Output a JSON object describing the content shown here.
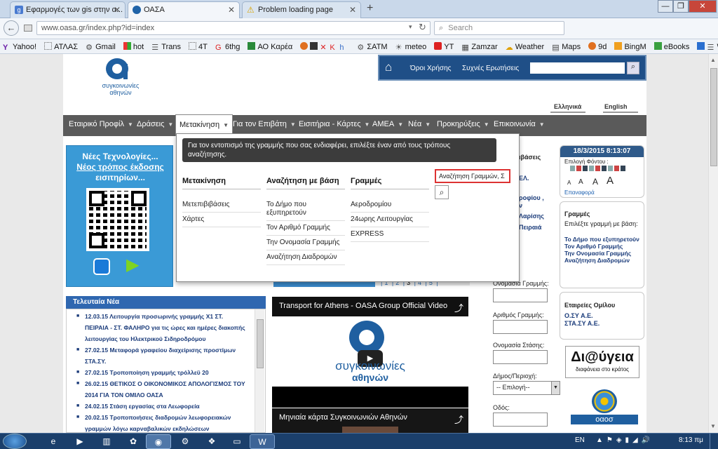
{
  "browser": {
    "tabs": [
      {
        "title": "Εφαρμογές των gis στην α...",
        "active": false
      },
      {
        "title": "ΟΑΣΑ",
        "active": true
      },
      {
        "title": "Problem loading page",
        "active": false
      }
    ],
    "new_tab_label": "+",
    "url": "www.oasa.gr/index.php?id=index",
    "search_placeholder": "Search",
    "bookmarks": [
      "Yahoo!",
      "ΑΤΛΑΣ",
      "Gmail",
      "hot",
      "Trans",
      "4T",
      "6thg",
      "ΑΟ Καρέα",
      "ΣΑΤΜ",
      "meteo",
      "YT",
      "Zamzar",
      "Weather",
      "Maps",
      "9d",
      "BingM",
      "eBooks",
      "WT"
    ]
  },
  "site": {
    "logo_text_line1": "συγκοινωνίες",
    "logo_text_line2": "αθηνών",
    "top_links": {
      "terms": "Όροι Χρήσης",
      "faq": "Συχνές Ερωτήσεις"
    },
    "languages": {
      "greek": "Ελληνικά",
      "english": "English"
    },
    "menu": [
      "Εταιρικό Προφίλ",
      "Δράσεις",
      "Μετακίνηση",
      "Για τον Επιβάτη",
      "Εισιτήρια - Κάρτες",
      "ΑΜΕΑ",
      "Νέα",
      "Προκηρύξεις",
      "Επικοινωνία"
    ],
    "dropdown": {
      "hint": "Για τον εντοπισμό της γραμμής που σας ενδιαφέρει, επιλέξτε έναν από τους τρόπους αναζήτησης.",
      "col1": {
        "title": "Μετακίνηση",
        "items": [
          "Μετεπιβιβάσεις",
          "Χάρτες"
        ]
      },
      "col2": {
        "title": "Αναζήτηση με βάση",
        "items": [
          "Το Δήμο που εξυπηρετούν",
          "Τον Αριθμό Γραμμής",
          "Την Ονομασία Γραμμής",
          "Αναζήτηση Διαδρομών"
        ]
      },
      "col3": {
        "title": "Γραμμές",
        "items": [
          "Αεροδρομίου",
          "24ωρης Λειτουργίας",
          "EXPRESS"
        ]
      },
      "search_value": "Αναζήτηση Γραμμών, Σ"
    },
    "promo": {
      "line1": "Νέες Τεχνολογίες...",
      "line2": "Νέος τρόπος έκδοσης",
      "line3": "εισιτηρίων..."
    },
    "pager": [
      "1",
      "2",
      "3",
      "4",
      "5"
    ],
    "latest_news": {
      "title": "Τελευταία Νέα",
      "items": [
        "12.03.15 Λειτουργία προσωρινής γραμμής Χ1 ΣΤ. ΠΕΙΡΑΙΑ - ΣΤ. ΦΑΛΗΡΟ για τις ώρες και ημέρες διακοπής λειτουργίας του Ηλεκτρικού Σιδηροδρόμου",
        "27.02.15 Μεταφορά γραφείου διαχείρισης προστίμων ΣΤΑ.ΣΥ.",
        "27.02.15 Τροποποίηση γραμμής τρόλλεϋ 20",
        "26.02.15 ΘΕΤΙΚΟΣ Ο ΟΙΚΟΝΟΜΙΚΟΣ ΑΠΟΛΟΓΙΣΜΟΣ ΤΟΥ 2014 ΓΙΑ ΤΟΝ ΟΜΙΛΟ ΟΑΣΑ",
        "24.02.15 Στάση εργασίας στα Λεωφορεία",
        "20.02.15 Τροποποιήσεις διαδρομών λεωφορειακών γραμμών λόγω καρναβαλικών εκδηλώσεων"
      ]
    },
    "video1_title": "Transport for Athens - OASA Group Official Video",
    "video2_title": "Μηνιαία κάρτα Συγκοινωνιών Αθηνών",
    "partial_links": {
      "l1": "ιβάσεις",
      "l2": "ΕΛ.",
      "l3": "ροφίου ,",
      "l4": "ν",
      "l5": "Λαρίσης",
      "l6": "Πειραιά"
    },
    "search_form": {
      "line_name": "Ονομασία Γραμμής:",
      "line_number": "Αριθμός Γραμμής:",
      "stop_name": "Ονομασία Στάσης:",
      "municipality": "Δήμος/Περιοχή:",
      "municipality_select": "-- Επιλογή--",
      "street": "Οδός:"
    },
    "right": {
      "datetime": "18/3/2015 8:13:07",
      "font_color_label": "Επιλογή Φόντου :",
      "font_sizes": [
        "A",
        "A",
        "A",
        "A"
      ],
      "reset": "Επαναφορά",
      "lines_title": "Γραμμές",
      "lines_desc": "Επιλέξτε γραμμή με βάση:",
      "lines_links": [
        "Το Δήμο που εξυπηρετούν",
        "Τον Αριθμό Γραμμής",
        "Την Ονομασία Γραμμής",
        "Αναζήτηση Διαδρομών"
      ],
      "companies_title": "Εταιρείες Ομίλου",
      "companies": [
        "Ο.ΣΥ Α.Ε.",
        "ΣΤΑ.ΣΥ Α.Ε."
      ],
      "diavgeia": "Δι@ύγεια",
      "diavgeia_sub": "διαφάνεια στο κράτος",
      "oasa": "οαοσ"
    }
  },
  "taskbar": {
    "lang": "EN",
    "time": "8:13 πμ"
  }
}
